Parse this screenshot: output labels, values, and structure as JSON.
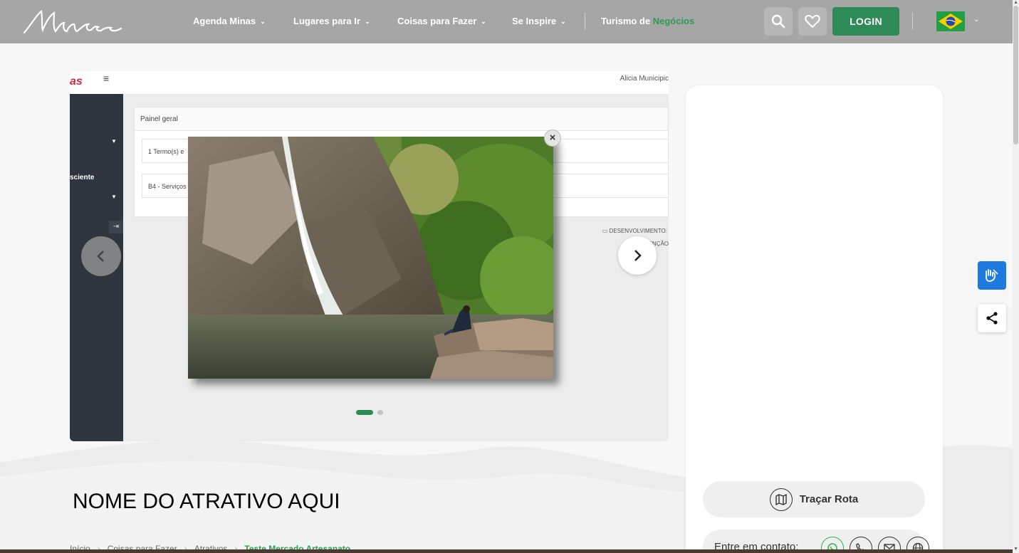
{
  "header": {
    "logo_text": "Minas",
    "nav": [
      {
        "label": "Agenda Minas"
      },
      {
        "label": "Lugares para Ir"
      },
      {
        "label": "Coisas para Fazer"
      },
      {
        "label": "Se Inspire"
      }
    ],
    "business": {
      "prefix": "Turismo de ",
      "highlight": "Negócios"
    },
    "login_label": "LOGIN",
    "icons": {
      "search": "search-icon",
      "favorites": "heart-icon",
      "language": "brazil-flag"
    }
  },
  "gallery": {
    "admin_preview": {
      "user": "Alicia Municipic",
      "sidebar_text": "sciente",
      "panel_title": "Painel geral",
      "rows": [
        "1 Termo(s) e",
        "B4 - Serviços"
      ],
      "dev_label": "DESENVOLVIMENTO:",
      "attention_label": "ENÇÃO"
    },
    "lightbox": {
      "close_label": "×",
      "image_description": "waterfall-photo"
    },
    "prev_label": "‹",
    "next_label": "›",
    "slides_total": 2,
    "slide_active": 1
  },
  "attraction": {
    "title": "NOME DO ATRATIVO AQUI",
    "breadcrumb": [
      "Início",
      "Coisas para Fazer",
      "Atrativos",
      "Teste Mercado Artesanato"
    ]
  },
  "sidebar_card": {
    "route_label": "Traçar Rota",
    "contact_label": "Entre em contato:",
    "contact_icons": [
      "whatsapp-icon",
      "phone-icon",
      "mail-icon",
      "globe-icon"
    ]
  },
  "floating": {
    "accessibility": "vlibras-icon",
    "share": "share-icon"
  },
  "colors": {
    "brand_green": "#2e8b57",
    "accent_green": "#2e9b55",
    "header_gray": "#a6a6a6",
    "vlibras_blue": "#1f7ae0"
  }
}
